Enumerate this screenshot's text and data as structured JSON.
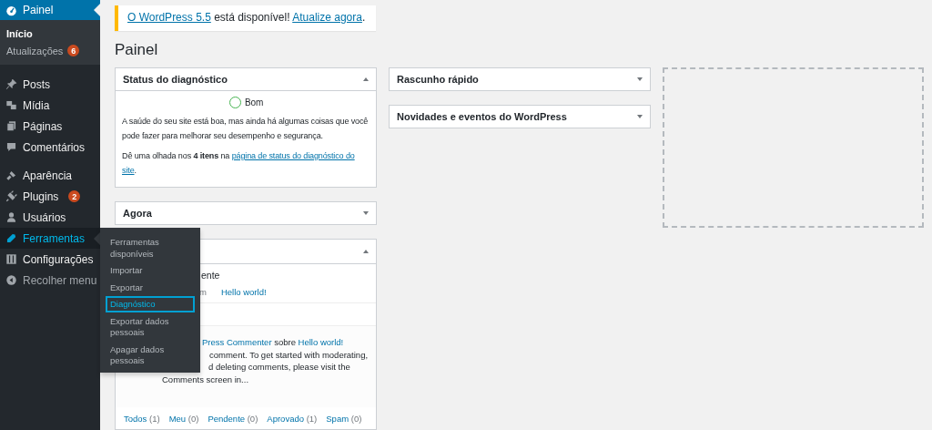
{
  "sidebar": {
    "header": {
      "label": "Painel",
      "selected": true
    },
    "submenu": [
      {
        "label": "Início",
        "selected": true
      },
      {
        "label": "Atualizações",
        "badge": "6",
        "selected": false
      }
    ],
    "groups": [
      [
        {
          "label": "Posts",
          "selected": false
        },
        {
          "label": "Mídia",
          "selected": false
        },
        {
          "label": "Páginas",
          "selected": false
        },
        {
          "label": "Comentários",
          "selected": false
        }
      ],
      [
        {
          "label": "Aparência",
          "selected": false
        },
        {
          "label": "Plugins",
          "badge": "2",
          "selected": false
        },
        {
          "label": "Usuários",
          "selected": false
        },
        {
          "label": "Ferramentas",
          "selected": true
        },
        {
          "label": "Configurações",
          "selected": false
        },
        {
          "label": "Recolher menu",
          "kind": "collapse",
          "selected": false
        }
      ]
    ]
  },
  "flyout": [
    {
      "label": "Ferramentas disponíveis",
      "selected": false
    },
    {
      "label": "Importar",
      "selected": false
    },
    {
      "label": "Exportar",
      "selected": false
    },
    {
      "label": "Diagnóstico",
      "selected": true
    },
    {
      "label": "Exportar dados pessoais",
      "selected": false
    },
    {
      "label": "Apagar dados pessoais",
      "selected": false
    }
  ],
  "notice": {
    "link1": "O WordPress 5.5",
    "text": " está disponível! ",
    "link2": "Atualize agora",
    "end": "."
  },
  "page_title": "Painel",
  "status_widget": {
    "title": "Status do diagnóstico",
    "expanded": true,
    "status": "Bom",
    "text": "A saúde do seu site está boa, mas ainda há algumas coisas que você pode fazer para melhorar seu desempenho e segurança.",
    "hint_before": "Dê uma olhada nos ",
    "hint_bold": "4 itens",
    "hint_mid": " na ",
    "hint_link_lines": [
      "página de status do diagnóstico do",
      "site"
    ],
    "hint_end": "."
  },
  "agora_widget": {
    "title": "Agora",
    "expanded": false
  },
  "activity_widget": {
    "expanded": true,
    "heading_part": "ente",
    "date_part": "m",
    "post_link": "Hello world!",
    "comment": {
      "author_link": "Press Commenter",
      "about": "sobre",
      "post_link": "Hello world!",
      "lines": [
        "comment. To get started with moderating,",
        "d deleting comments, please visit the",
        "Comments screen in..."
      ]
    },
    "filters": [
      {
        "label": "Todos",
        "count": "(1)"
      },
      {
        "label": "Meu",
        "count": "(0)"
      },
      {
        "label": "Pendente",
        "count": "(0)"
      },
      {
        "label": "Aprovado",
        "count": "(1)"
      },
      {
        "label": "Spam",
        "count": "(0)"
      }
    ]
  },
  "column2": [
    {
      "title": "Rascunho rápido",
      "expanded": false
    },
    {
      "title": "Novidades e eventos do WordPress",
      "expanded": false
    }
  ]
}
